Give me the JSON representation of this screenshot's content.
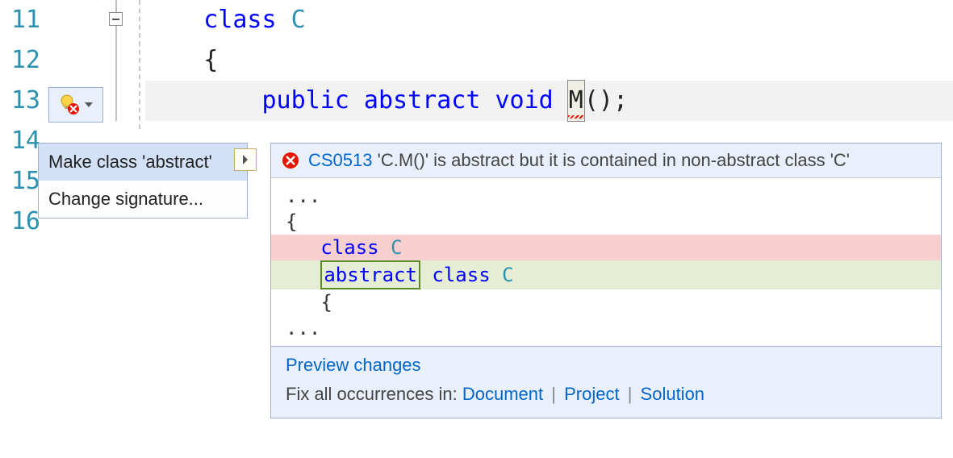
{
  "lineNumbers": [
    "11",
    "12",
    "13",
    "14",
    "15",
    "16"
  ],
  "code": {
    "l11": {
      "kw": "class ",
      "type": "C"
    },
    "l12": "{",
    "l13": {
      "mods": "public abstract void ",
      "name": "M",
      "after": "();"
    }
  },
  "quickActions": {
    "items": [
      {
        "label": "Make class 'abstract'",
        "selected": true,
        "hasSubmenu": true
      },
      {
        "label": "Change signature...",
        "selected": false,
        "hasSubmenu": false
      }
    ]
  },
  "preview": {
    "errorCode": "CS0513",
    "errorText": "'C.M()' is abstract but it is contained in non-abstract class 'C'",
    "diff": {
      "ellipsisTop": "...",
      "brace": "{",
      "removed": {
        "kw": "class ",
        "type": "C"
      },
      "added": {
        "abs": "abstract",
        "space": " ",
        "kw": "class ",
        "type": "C"
      },
      "openBrace": "{",
      "ellipsisBottom": "..."
    },
    "footer": {
      "previewLink": "Preview changes",
      "fixLabel": "Fix all occurrences in: ",
      "scopes": [
        "Document",
        "Project",
        "Solution"
      ],
      "sep": " | "
    }
  }
}
